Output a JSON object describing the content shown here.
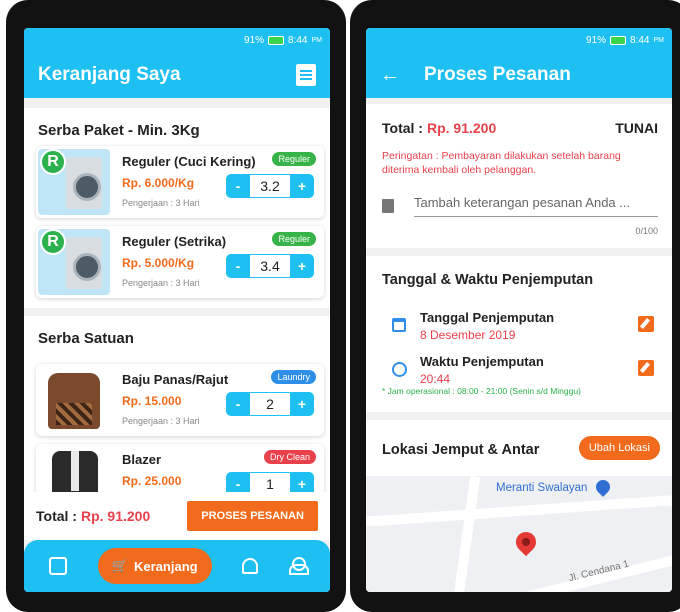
{
  "status": {
    "battery": "91%",
    "time": "8:44",
    "ampm": "PM"
  },
  "left": {
    "title": "Keranjang Saya",
    "section1": {
      "title": "Serba Paket - Min. 3Kg",
      "items": [
        {
          "name": "Reguler (Cuci Kering)",
          "price": "Rp. 6.000/Kg",
          "work": "Pengerjaan : 3 Hari",
          "tag": "Reguler",
          "qty": "3.2",
          "badge": "R"
        },
        {
          "name": "Reguler (Setrika)",
          "price": "Rp. 5.000/Kg",
          "work": "Pengerjaan : 3 Hari",
          "tag": "Reguler",
          "qty": "3.4",
          "badge": "R"
        }
      ]
    },
    "section2": {
      "title": "Serba Satuan",
      "items": [
        {
          "name": "Baju Panas/Rajut",
          "price": "Rp. 15.000",
          "work": "Pengerjaan : 3 Hari",
          "tag": "Laundry",
          "qty": "2"
        },
        {
          "name": "Blazer",
          "price": "Rp. 25.000",
          "work": "",
          "tag": "Dry Clean",
          "qty": "1"
        }
      ]
    },
    "stepper": {
      "minus": "-",
      "plus": "+"
    },
    "total": {
      "label": "Total :",
      "value": "Rp. 91.200"
    },
    "process_button": "PROSES PESANAN",
    "nav": {
      "cart_label": "Keranjang"
    }
  },
  "right": {
    "title": "Proses Pesanan",
    "back": "←",
    "total": {
      "label": "Total :",
      "value": "Rp. 91.200",
      "payment": "TUNAI"
    },
    "warning": "Peringatan : Pembayaran dilakukan setelah barang diterima kembali oleh pelanggan.",
    "note": {
      "placeholder": "Tambah keterangan pesanan Anda ...",
      "counter": "0/100"
    },
    "schedule": {
      "title": "Tanggal & Waktu Penjemputan",
      "date_label": "Tanggal Penjemputan",
      "date_value": "8 Desember 2019",
      "time_label": "Waktu Penjemputan",
      "time_value": "20:44",
      "hours_note": "* Jam operasional : 08:00 - 21:00 (Senin s/d Minggu)"
    },
    "location": {
      "title": "Lokasi Jemput & Antar",
      "change_button": "Ubah Lokasi",
      "map_place": "Meranti Swalayan",
      "street": "Jl. Cendana 1"
    }
  },
  "colors": {
    "primary": "#1ec0f2",
    "accent": "#f26a1b",
    "danger": "#e8414b",
    "success": "#37b34a"
  }
}
